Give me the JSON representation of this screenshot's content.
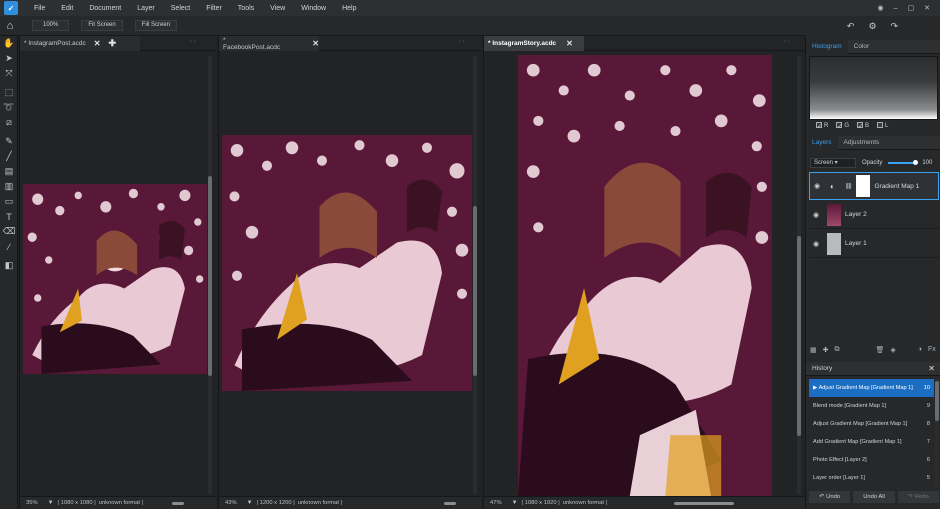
{
  "menu": [
    "File",
    "Edit",
    "Document",
    "Layer",
    "Select",
    "Filter",
    "Tools",
    "View",
    "Window",
    "Help"
  ],
  "optbar": {
    "zoom": "100%",
    "fit": "Fit Screen",
    "fill": "Fill Screen"
  },
  "documents": [
    {
      "tab": "* InstagramPost.acdc",
      "zoom": "35%",
      "info": "| 1080 x 1080 |",
      "format": "unknown format |"
    },
    {
      "tab": "* FacebookPost.acdc",
      "zoom": "43%",
      "info": "| 1200 x 1200 |",
      "format": "unknown format |"
    },
    {
      "tab": "* InstagramStory.acdc",
      "zoom": "47%",
      "info": "| 1080 x 1920 |",
      "format": "unknown format |"
    }
  ],
  "panels": {
    "top_tabs": [
      "Histogram",
      "Color"
    ],
    "channels": [
      "R",
      "G",
      "B",
      "L"
    ],
    "layer_tabs": [
      "Layers",
      "Adjustments"
    ],
    "blend_mode": "Screen",
    "opacity_label": "Opacity",
    "opacity_value": "100",
    "layers": [
      {
        "name": "Gradient Map 1"
      },
      {
        "name": "Layer 2"
      },
      {
        "name": "Layer 1"
      }
    ],
    "history_title": "History",
    "history": [
      {
        "label": "Adjust Gradient Map [Gradient Map 1]",
        "num": "10"
      },
      {
        "label": "Blend mode [Gradient Map 1]",
        "num": "9"
      },
      {
        "label": "Adjust Gradient Map [Gradient Map 1]",
        "num": "8"
      },
      {
        "label": "Add Gradient Map [Gradient Map 1]",
        "num": "7"
      },
      {
        "label": "Photo Effect [Layer 2]",
        "num": "6"
      },
      {
        "label": "Layer order [Layer 1]",
        "num": "5"
      }
    ],
    "history_buttons": {
      "undo": "Undo",
      "undo_all": "Undo All",
      "redo": "Redo"
    }
  },
  "colors": {
    "accent": "#3aa0f0",
    "history_selected": "#1b6ec2",
    "photo_tint": "#6a1f3f"
  }
}
